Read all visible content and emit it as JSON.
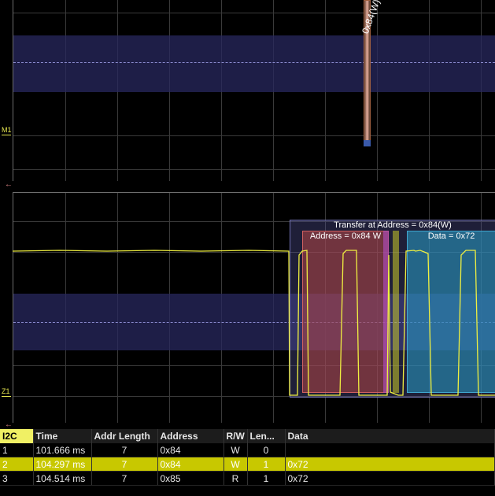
{
  "channels": {
    "math_label": "M1",
    "zoom_label": "Z1"
  },
  "math_marker_text": "0x84(W)",
  "decode_overlay": {
    "transfer_label": "Transfer at Address = 0x84(W)",
    "address_label": "Address = 0x84 W",
    "data_label": "Data = 0x72"
  },
  "table": {
    "headers": [
      "I2C",
      "Time",
      "Addr Length",
      "Address",
      "R/W",
      "Len...",
      "Data"
    ],
    "rows": [
      {
        "index": "1",
        "time": "101.666 ms",
        "addr_length": "7",
        "address": "0x84",
        "rw": "W",
        "len": "0",
        "data": ""
      },
      {
        "index": "2",
        "time": "104.297 ms",
        "addr_length": "7",
        "address": "0x84",
        "rw": "W",
        "len": "1",
        "data": "0x72"
      },
      {
        "index": "3",
        "time": "104.514 ms",
        "addr_length": "7",
        "address": "0x85",
        "rw": "R",
        "len": "1",
        "data": "0x72"
      }
    ],
    "selected_row": 2
  },
  "colors": {
    "trace": "#f0f040",
    "transfer_overlay": "#5a5a9a",
    "address_overlay": "#b04848",
    "data_overlay": "#2f8fb0",
    "selected_row": "#c8c800"
  }
}
